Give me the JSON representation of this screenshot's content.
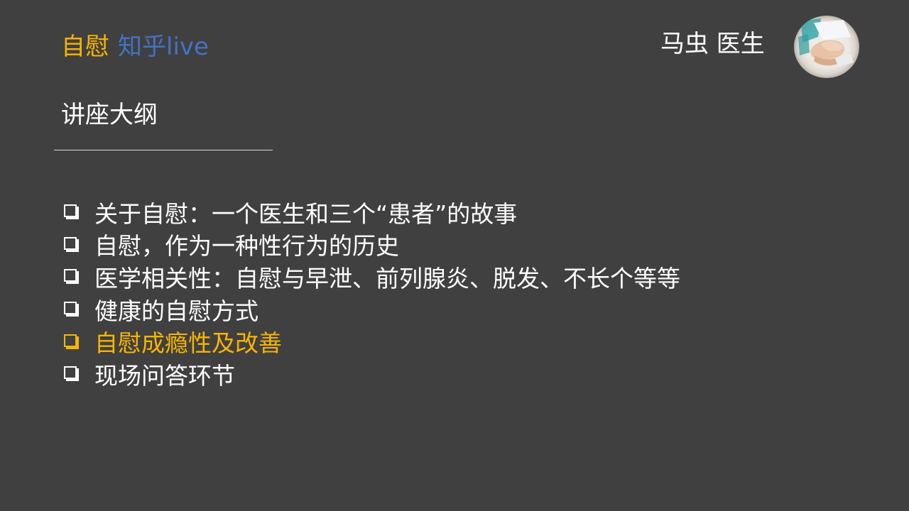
{
  "header": {
    "title_accent": "自慰",
    "title_platform": "知乎live",
    "author": "马虫 医生",
    "avatar_icon": "doctor-hands-avatar-icon"
  },
  "section": {
    "title": "讲座大纲"
  },
  "outline": {
    "bullet_icon": "checkbox-bullet-icon",
    "items": [
      {
        "label": "关于自慰：一个医生和三个“患者”的故事"
      },
      {
        "label": "自慰，作为一种性行为的历史"
      },
      {
        "label": "医学相关性：自慰与早泄、前列腺炎、脱发、不长个等等"
      },
      {
        "label": "健康的自慰方式"
      },
      {
        "label": "自慰成瘾性及改善"
      },
      {
        "label": "现场问答环节"
      }
    ]
  },
  "colors": {
    "background": "#404040",
    "accent_gold": "#f7b500",
    "zhihu_blue": "#4472c4",
    "text": "#ffffff"
  }
}
